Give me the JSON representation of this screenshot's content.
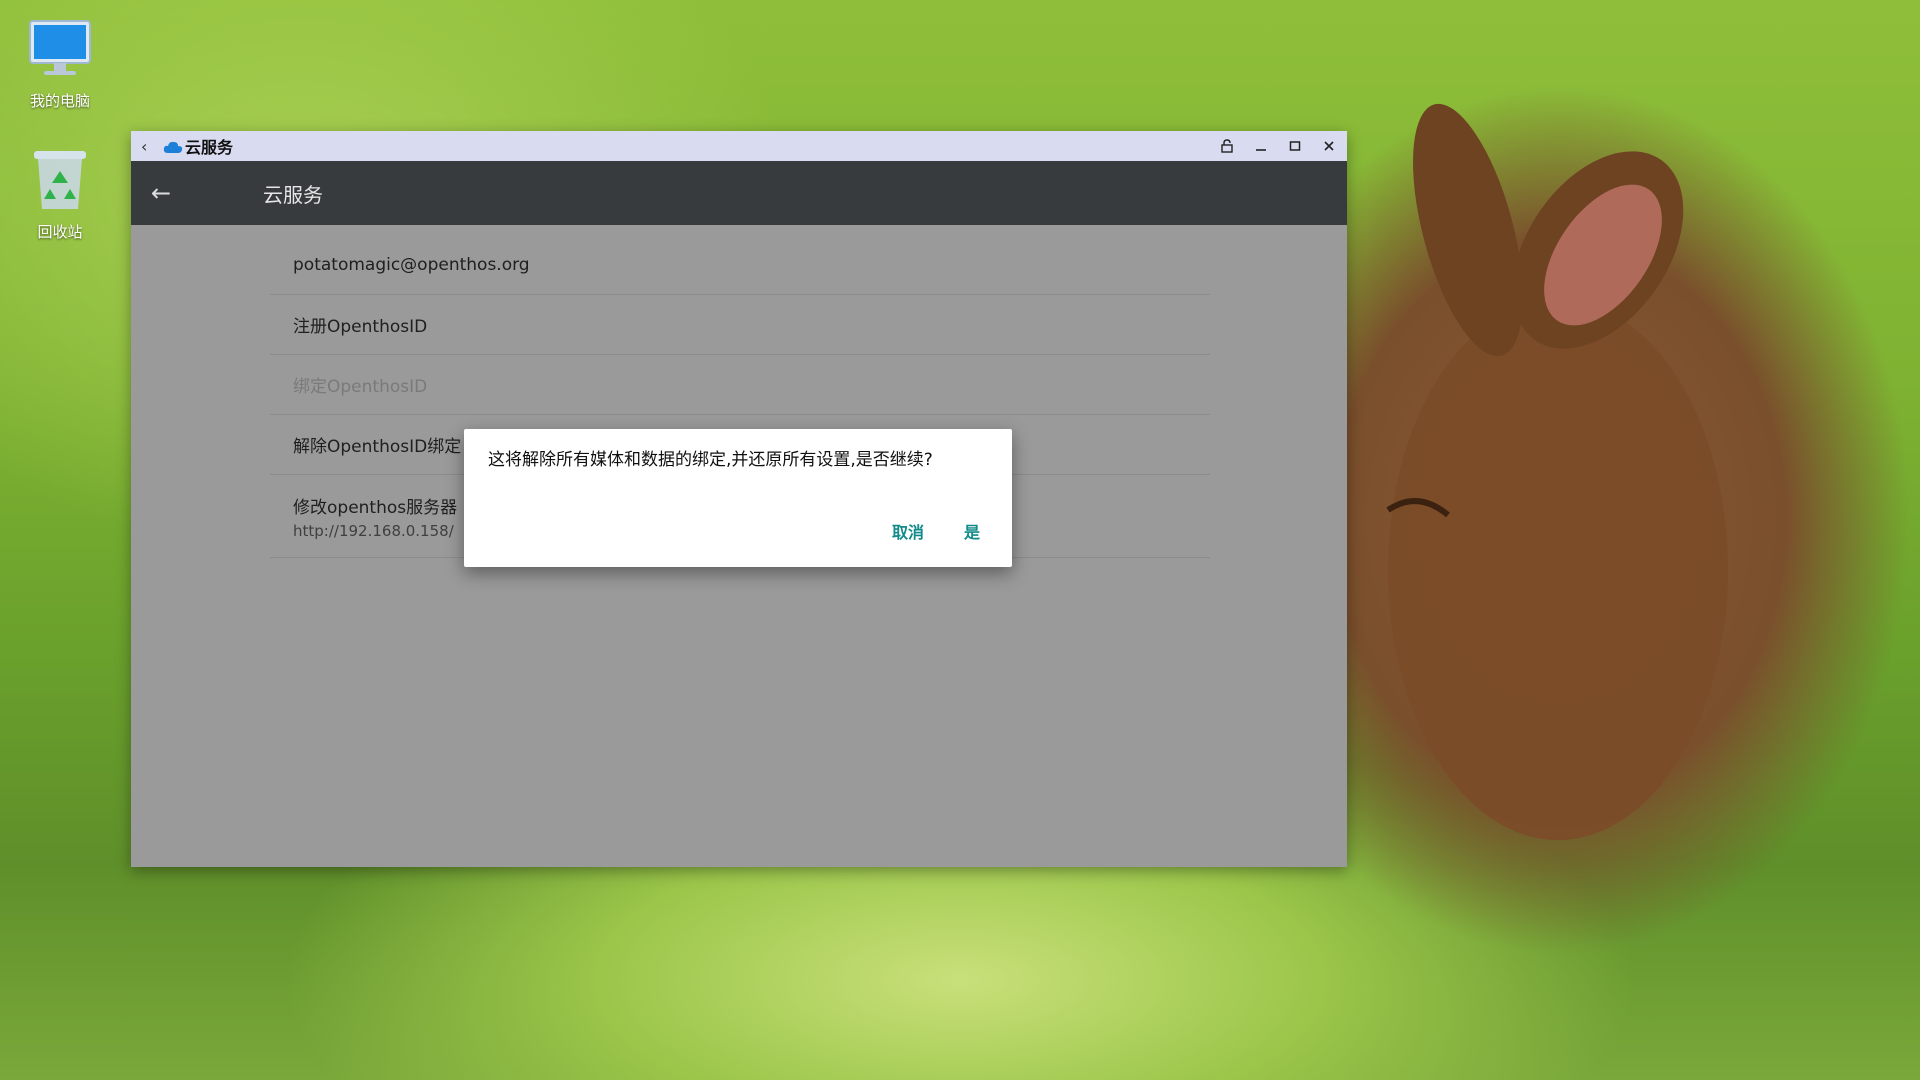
{
  "desktop": {
    "icons": [
      {
        "label": "我的电脑",
        "icon": "computer-icon"
      },
      {
        "label": "回收站",
        "icon": "recycle-bin-icon"
      }
    ]
  },
  "window": {
    "title": "云服务",
    "controls": [
      "lock-icon",
      "minimize-icon",
      "maximize-icon",
      "close-icon"
    ]
  },
  "appbar": {
    "title": "云服务"
  },
  "list": {
    "items": [
      {
        "label": "potatomagic@openthos.org"
      },
      {
        "label": "注册OpenthosID"
      },
      {
        "label": "绑定OpenthosID"
      },
      {
        "label": "解除OpenthosID绑定"
      },
      {
        "label": "修改openthos服务器",
        "sub": "http://192.168.0.158/"
      }
    ]
  },
  "dialog": {
    "message": "这将解除所有媒体和数据的绑定,并还原所有设置,是否继续?",
    "cancel": "取消",
    "confirm": "是"
  }
}
